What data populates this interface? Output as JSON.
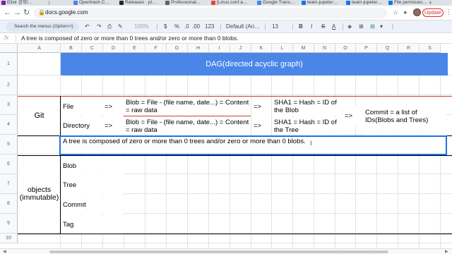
{
  "browser": {
    "tabs": [
      {
        "label": "Elixir 공학/…",
        "color": "#7b1fa2"
      },
      {
        "label": "Openhash C…",
        "color": "#4285f4"
      },
      {
        "label": "Releases · pl…",
        "color": "#24292f"
      },
      {
        "label": "Professional…",
        "color": "#5f6368"
      },
      {
        "label": "[Linux.conf.a…",
        "color": "#ea4335"
      },
      {
        "label": "Google Trans…",
        "color": "#4285f4"
      },
      {
        "label": "team-jupeter…",
        "color": "#1a73e8"
      },
      {
        "label": "team-jupeter…",
        "color": "#1a73e8"
      },
      {
        "label": "File permissio…",
        "color": "#1a73e8"
      }
    ],
    "new_tab": "+",
    "url": "docs.google.com",
    "update_label": "Update"
  },
  "toolbar": {
    "search_placeholder": "Search the menus (Option+/)",
    "zoom": "100%",
    "currency": "$",
    "percent": "%",
    "dec_less": ".0",
    "dec_more": ".00",
    "number_format": "123",
    "font_name": "Default (Ari…",
    "font_size": "13",
    "bold": "B",
    "italic": "I",
    "strike": "S",
    "text_color": "A"
  },
  "formula_bar": {
    "fx": "fx",
    "content": "A tree is composed of zero or more than 0 trees and/or zero or more than 0 blobs."
  },
  "columns": [
    "A",
    "B",
    "C",
    "D",
    "E",
    "F",
    "G",
    "H",
    "I",
    "J",
    "K",
    "L",
    "M",
    "N",
    "O",
    "P",
    "Q",
    "R",
    "S"
  ],
  "rows": [
    "1",
    "2",
    "3",
    "4",
    "5",
    "6",
    "7",
    "8",
    "9",
    "10"
  ],
  "cells": {
    "title": "DAG(directed acyclic graph)",
    "git": "Git",
    "file": "File",
    "directory": "Directory",
    "arrow1": "=>",
    "arrow2": "=>",
    "arrow3": "=>",
    "arrow4": "=>",
    "arrow5": "=>",
    "blob_def1": "Blob = File - (file name, date...) = Content = raw data",
    "blob_def2": "Blob = File - (file name, date...) = Content = raw data",
    "sha_blob": "SHA1 = Hash = ID of the Blob",
    "sha_tree": "SHA1 = Hash = ID of the Tree",
    "commit_def": "Commit = a list of IDs(Blobs and Trees)",
    "tree_desc": "A tree is composed of zero or more than 0 trees and/or zero or more than 0 blobs.",
    "objects": "objects (immutable)",
    "blob": "Blob",
    "tree": "Tree",
    "commit": "Commit",
    "tag": "Tag"
  },
  "colors": {
    "title_band": "#4a86e8",
    "selection": "#1a73e8",
    "red_border": "#cc4125"
  }
}
